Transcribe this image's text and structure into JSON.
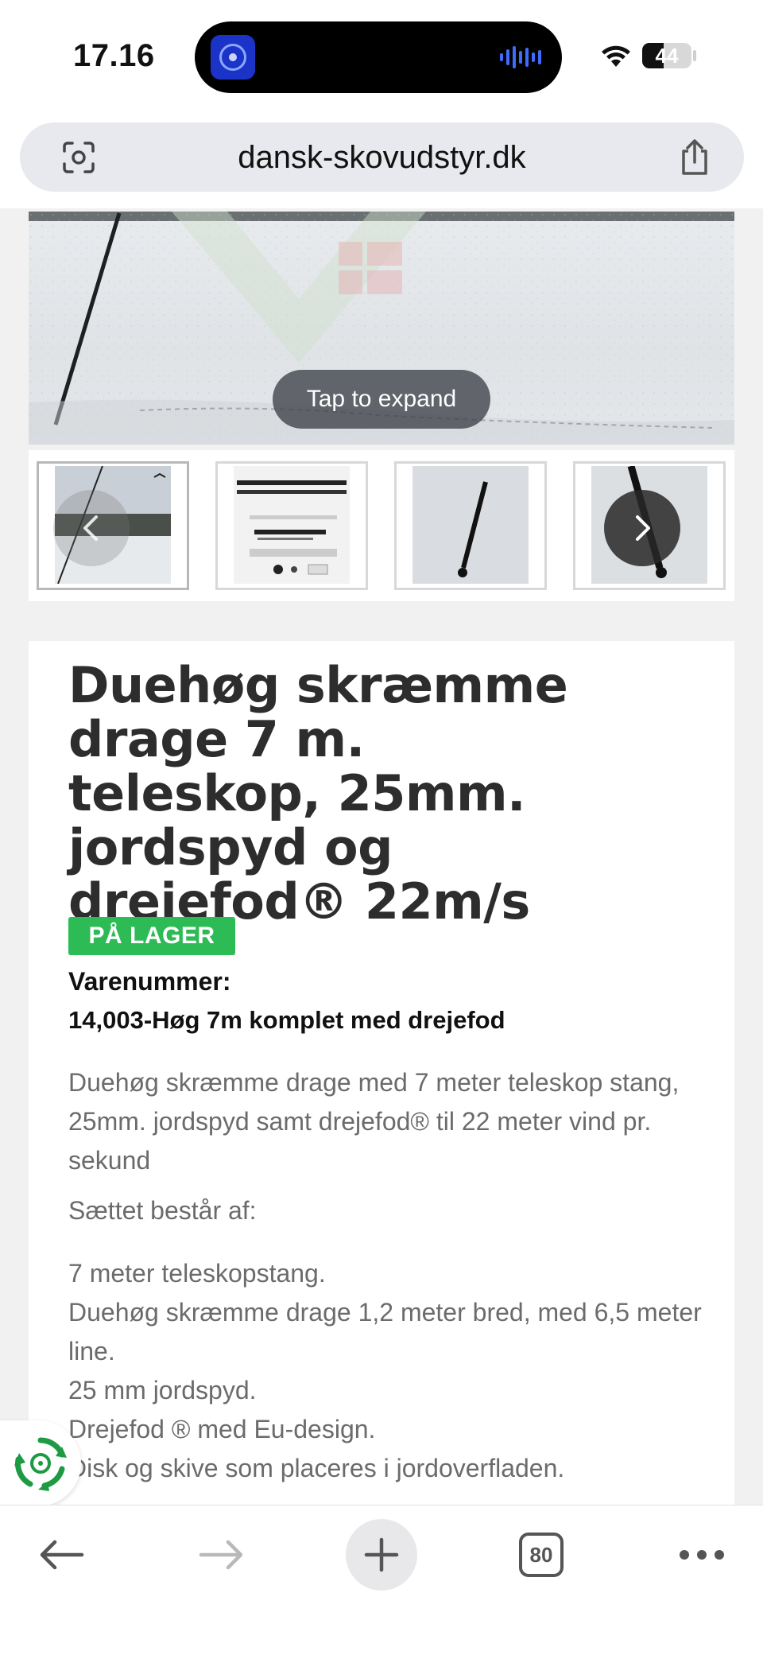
{
  "status_bar": {
    "time": "17.16",
    "battery": "44",
    "battery_level": 0.44
  },
  "browser": {
    "url": "dansk-skovudstyr.dk"
  },
  "gallery": {
    "tap_to_expand": "Tap to expand",
    "thumbnails": [
      "thumb-1",
      "thumb-2",
      "thumb-3",
      "thumb-4"
    ],
    "active_index": 0
  },
  "product": {
    "title": "Duehøg skræmme drage 7 m. teleskop, 25mm. jordspyd og drejefod® 22m/s",
    "stock_badge": "PÅ LAGER",
    "sku_label": "Varenummer:",
    "sku_value": "14,003-Høg 7m komplet med drejefod",
    "description": "Duehøg skræmme drage med 7 meter teleskop stang, 25mm. jordspyd samt drejefod®  til 22 meter vind pr. sekund",
    "set_title": "Sættet består af:",
    "set_items": [
      "7 meter teleskopstang.",
      "Duehøg skræmme drage 1,2 meter bred, med 6,5 meter line.",
      "25 mm jordspyd.",
      "Drejefod ® med Eu-design.",
      "Disk og skive som placeres i jordoverfladen."
    ]
  },
  "toolbar": {
    "tab_count": "80"
  },
  "colors": {
    "stock_green": "#2dbb55",
    "url_bar": "#e7e9ee",
    "text_gray": "#6b6b6b"
  }
}
